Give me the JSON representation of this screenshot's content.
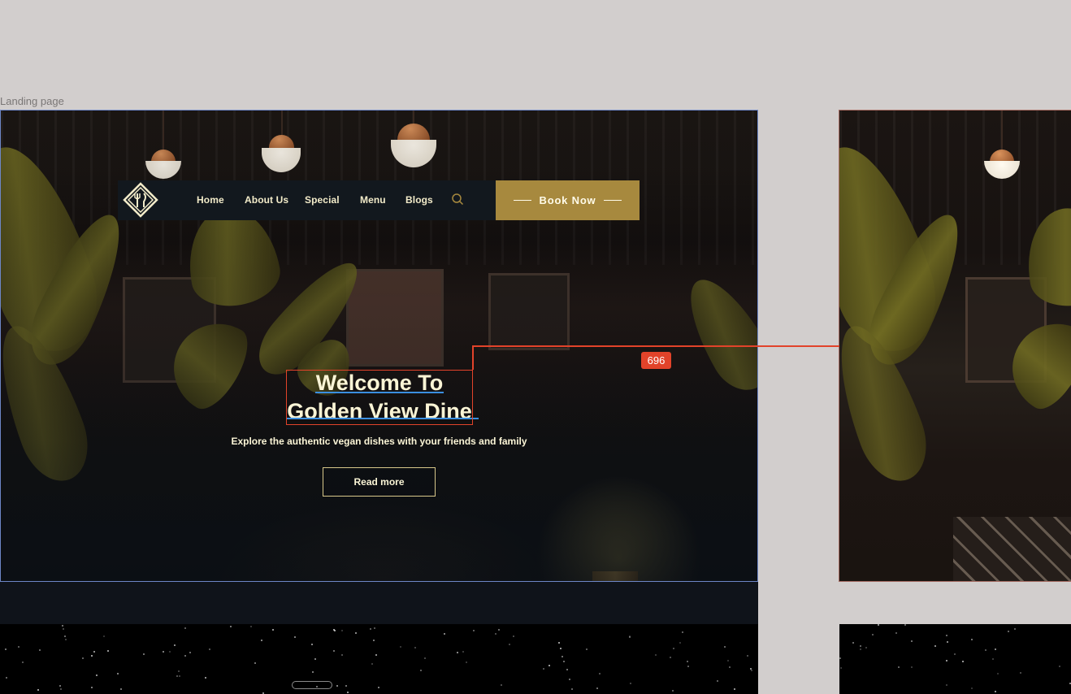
{
  "canvas": {
    "frame_label": "Landing page",
    "measurement_badge": "696"
  },
  "nav": {
    "items": [
      "Home",
      "About Us",
      "Special",
      "Menu",
      "Blogs"
    ],
    "book_label": "Book Now"
  },
  "hero": {
    "title_line1": "Welcome To",
    "title_line2": "Golden View Dine",
    "subtitle": "Explore the authentic vegan dishes with your friends and family",
    "cta_label": "Read more"
  },
  "colors": {
    "accent_gold": "#a7893e",
    "cream_text": "#fbf5d6",
    "nav_bg": "#12181e",
    "selection_red": "#e2432a",
    "guide_blue": "#3b8fe0",
    "canvas_bg": "#d2cecd"
  },
  "icons": {
    "logo": "diamond-fork-knife-logo",
    "search": "search-icon"
  }
}
